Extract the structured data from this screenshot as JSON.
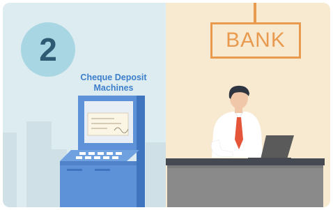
{
  "step": {
    "number": "2"
  },
  "atm": {
    "label": "Cheque Deposit Machines"
  },
  "bank_sign": {
    "text": "BANK"
  },
  "colors": {
    "left_bg": "#dcecf1",
    "right_bg": "#f8e9d1",
    "circle": "#a9d6e3",
    "label_blue": "#3d7ecb",
    "sign_orange": "#e89a4f",
    "machine_blue": "#5e92d8",
    "counter_gray": "#8a8a8a",
    "tie_red": "#e4553a"
  }
}
